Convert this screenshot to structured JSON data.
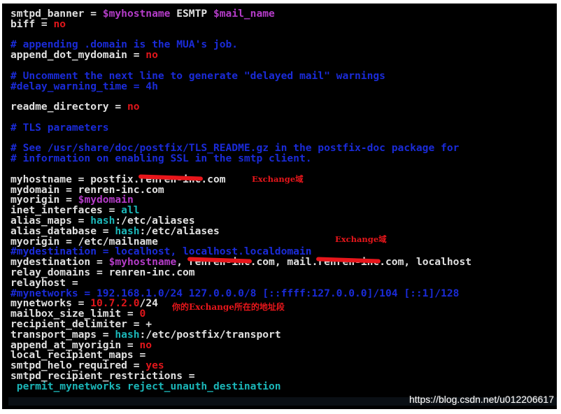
{
  "terminal": {
    "lines": [
      [
        {
          "t": "smtpd_banner = ",
          "c": "plain"
        },
        {
          "t": "$myhostname",
          "c": "variable"
        },
        {
          "t": " ESMTP ",
          "c": "plain"
        },
        {
          "t": "$mail_name",
          "c": "variable"
        }
      ],
      [
        {
          "t": "biff = ",
          "c": "plain"
        },
        {
          "t": "no",
          "c": "value-bool"
        }
      ],
      [],
      [
        {
          "t": "# appending .domain is the MUA's job.",
          "c": "comment"
        }
      ],
      [
        {
          "t": "append_dot_mydomain = ",
          "c": "plain"
        },
        {
          "t": "no",
          "c": "value-bool"
        }
      ],
      [],
      [
        {
          "t": "# Uncomment the next line to generate \"delayed mail\" warnings",
          "c": "comment"
        }
      ],
      [
        {
          "t": "#delay_warning_time = 4h",
          "c": "comment"
        }
      ],
      [],
      [
        {
          "t": "readme_directory = ",
          "c": "plain"
        },
        {
          "t": "no",
          "c": "value-bool"
        }
      ],
      [],
      [
        {
          "t": "# TLS parameters",
          "c": "comment"
        }
      ],
      [],
      [
        {
          "t": "# See /usr/share/doc/postfix/TLS_README.gz in the postfix-doc package for",
          "c": "comment"
        }
      ],
      [
        {
          "t": "# information on enabling SSL in the smtp client.",
          "c": "comment"
        }
      ],
      [],
      [
        {
          "t": "myhostname = postfix.",
          "c": "plain"
        },
        {
          "t": "renren-inc",
          "c": "plain",
          "redact": true
        },
        {
          "t": ".com",
          "c": "plain"
        }
      ],
      [
        {
          "t": "mydomain = renren-inc.com",
          "c": "plain"
        }
      ],
      [
        {
          "t": "myorigin = ",
          "c": "plain"
        },
        {
          "t": "$mydomain",
          "c": "variable"
        }
      ],
      [
        {
          "t": "inet_interfaces = ",
          "c": "plain"
        },
        {
          "t": "all",
          "c": "keyword"
        }
      ],
      [
        {
          "t": "alias_maps = ",
          "c": "plain"
        },
        {
          "t": "hash",
          "c": "keyword"
        },
        {
          "t": ":/etc/aliases",
          "c": "plain"
        }
      ],
      [
        {
          "t": "alias_database = ",
          "c": "plain"
        },
        {
          "t": "hash",
          "c": "keyword"
        },
        {
          "t": ":/etc/aliases",
          "c": "plain"
        }
      ],
      [
        {
          "t": "myorigin = /etc/mailname",
          "c": "plain"
        }
      ],
      [
        {
          "t": "#mydestination = localhost, localhost.localdomain",
          "c": "comment"
        }
      ],
      [
        {
          "t": "mydestination = ",
          "c": "plain"
        },
        {
          "t": "$myhostname",
          "c": "variable"
        },
        {
          "t": ", ",
          "c": "plain"
        },
        {
          "t": "renren-inc",
          "c": "plain",
          "redact": true
        },
        {
          "t": ".com, mail.",
          "c": "plain"
        },
        {
          "t": "renren-inc",
          "c": "plain",
          "redact": true
        },
        {
          "t": ".com, localhost",
          "c": "plain"
        }
      ],
      [
        {
          "t": "relay_domains = renren-inc.com",
          "c": "plain"
        }
      ],
      [
        {
          "t": "relayhost =",
          "c": "plain"
        }
      ],
      [
        {
          "t": "#mynetworks = 192.168.1.0/24 127.0.0.0/8 [::ffff:127.0.0.0]/104 [::1]/128",
          "c": "comment"
        }
      ],
      [
        {
          "t": "mynetworks = ",
          "c": "plain"
        },
        {
          "t": "10.7.2.0",
          "c": "dark-red"
        },
        {
          "t": "/24",
          "c": "plain"
        }
      ],
      [
        {
          "t": "mailbox_size_limit = ",
          "c": "plain"
        },
        {
          "t": "0",
          "c": "dark-red"
        }
      ],
      [
        {
          "t": "recipient_delimiter = +",
          "c": "plain"
        }
      ],
      [
        {
          "t": "transport_maps = ",
          "c": "plain"
        },
        {
          "t": "hash",
          "c": "keyword"
        },
        {
          "t": ":/etc/postfix/transport",
          "c": "plain"
        }
      ],
      [
        {
          "t": "append_at_myorigin = ",
          "c": "plain"
        },
        {
          "t": "no",
          "c": "value-bool"
        }
      ],
      [
        {
          "t": "local_recipient_maps =",
          "c": "plain"
        }
      ],
      [
        {
          "t": "smtpd_helo_required = ",
          "c": "plain"
        },
        {
          "t": "yes",
          "c": "value-bool"
        }
      ],
      [
        {
          "t": "smtpd_recipient_restrictions =",
          "c": "plain"
        }
      ],
      [
        {
          "t": " permit_mynetworks reject_unauth_destination",
          "c": "cyan"
        }
      ]
    ]
  },
  "annotations": {
    "exchange_domain_1": "Exchange域",
    "exchange_domain_2": "Exchange域",
    "exchange_subnet": "你的Exchange所在的地址段"
  },
  "watermark": "https://blog.csdn.net/u012206617",
  "colors": {
    "background": "#000000",
    "plain_text": "#e0e0e0",
    "comment": "#1a2bd8",
    "variable": "#b43cc8",
    "keyword": "#1bb6b8",
    "value": "#e0161b",
    "annotation": "#e8161b"
  }
}
